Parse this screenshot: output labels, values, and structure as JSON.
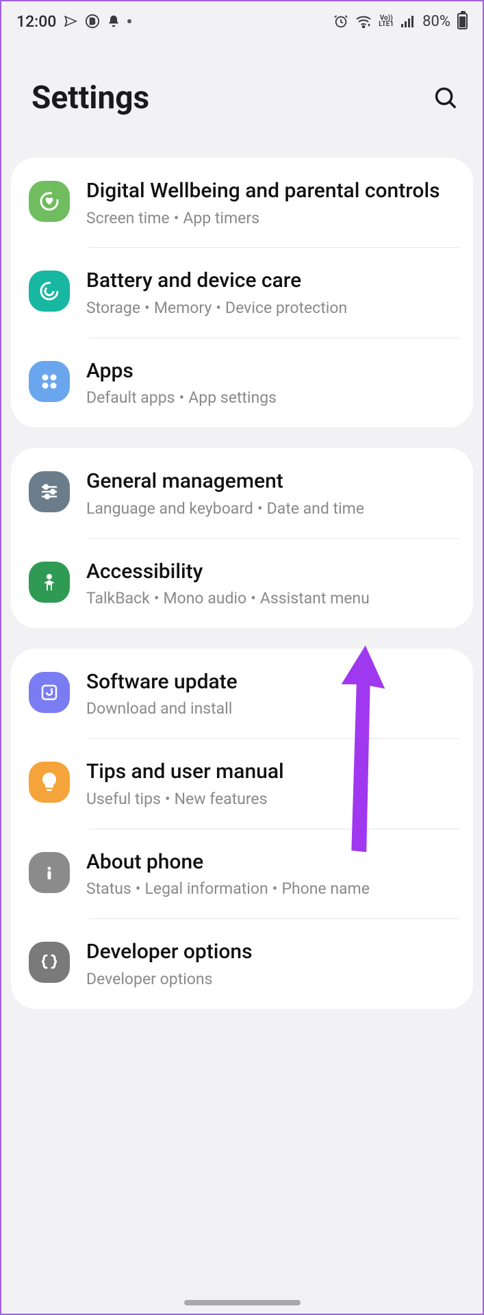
{
  "status": {
    "time": "12:00",
    "battery": "80%",
    "lte": "LTE1",
    "vo": "Vo))"
  },
  "page_title": "Settings",
  "groups": [
    {
      "items": [
        {
          "id": "digital-wellbeing",
          "icon_color": "#6fbd5e",
          "title": "Digital Wellbeing and parental controls",
          "subs": [
            "Screen time",
            "App timers"
          ]
        },
        {
          "id": "battery-care",
          "icon_color": "#18b7a1",
          "title": "Battery and device care",
          "subs": [
            "Storage",
            "Memory",
            "Device protection"
          ]
        },
        {
          "id": "apps",
          "icon_color": "#6aa6ee",
          "title": "Apps",
          "subs": [
            "Default apps",
            "App settings"
          ]
        }
      ]
    },
    {
      "items": [
        {
          "id": "general-management",
          "icon_color": "#6b7d8b",
          "title": "General management",
          "subs": [
            "Language and keyboard",
            "Date and time"
          ]
        },
        {
          "id": "accessibility",
          "icon_color": "#2f9a54",
          "title": "Accessibility",
          "subs": [
            "TalkBack",
            "Mono audio",
            "Assistant menu"
          ]
        }
      ]
    },
    {
      "items": [
        {
          "id": "software-update",
          "icon_color": "#7a7df2",
          "title": "Software update",
          "subs": [
            "Download and install"
          ]
        },
        {
          "id": "tips",
          "icon_color": "#f5a33b",
          "title": "Tips and user manual",
          "subs": [
            "Useful tips",
            "New features"
          ]
        },
        {
          "id": "about-phone",
          "icon_color": "#8b8b8b",
          "title": "About phone",
          "subs": [
            "Status",
            "Legal information",
            "Phone name"
          ]
        },
        {
          "id": "developer-options",
          "icon_color": "#7a7a7a",
          "title": "Developer options",
          "subs": [
            "Developer options"
          ]
        }
      ]
    }
  ],
  "icons": {
    "digital-wellbeing": "heart-ring",
    "battery-care": "spiral",
    "apps": "grid4",
    "general-management": "sliders",
    "accessibility": "person",
    "software-update": "refresh-box",
    "tips": "bulb",
    "about-phone": "info",
    "developer-options": "braces"
  }
}
